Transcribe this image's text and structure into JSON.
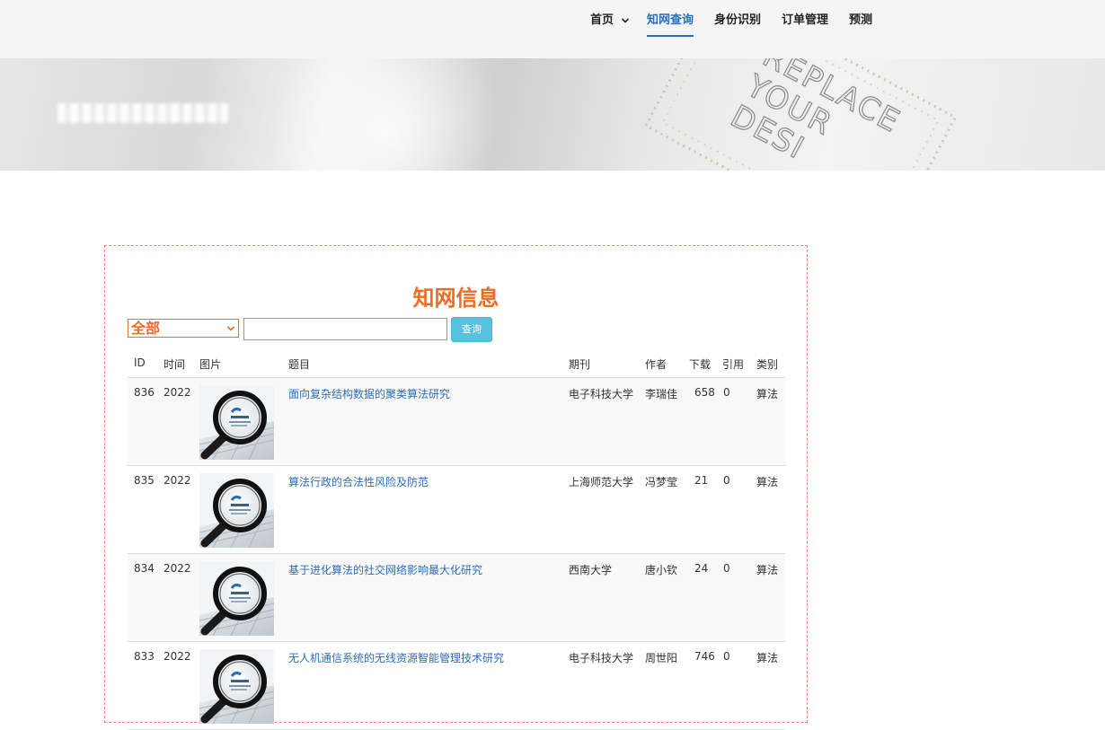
{
  "nav": {
    "items": [
      {
        "label": "首页",
        "has_dropdown": true,
        "active": false
      },
      {
        "label": "知网查询",
        "has_dropdown": false,
        "active": true
      },
      {
        "label": "身份识别",
        "has_dropdown": false,
        "active": false
      },
      {
        "label": "订单管理",
        "has_dropdown": false,
        "active": false
      },
      {
        "label": "预测",
        "has_dropdown": false,
        "active": false
      }
    ]
  },
  "banner": {
    "stamp_text": [
      "REPLACE",
      "YOUR",
      "DESI"
    ]
  },
  "panel": {
    "title": "知网信息",
    "filter": {
      "selected": "全部"
    },
    "search": {
      "value": "",
      "button_label": "查询"
    }
  },
  "table": {
    "headers": {
      "id": "ID",
      "time": "时间",
      "image": "图片",
      "title": "题目",
      "journal": "期刊",
      "author": "作者",
      "downloads": "下载",
      "citations": "引用",
      "category": "类别"
    },
    "rows": [
      {
        "id": "836",
        "time": "2022",
        "title": "面向复杂结构数据的聚类算法研究",
        "journal": "电子科技大学",
        "author": "李瑞佳",
        "downloads": "658",
        "citations": "0",
        "category": "算法"
      },
      {
        "id": "835",
        "time": "2022",
        "title": "算法行政的合法性风险及防范",
        "journal": "上海师范大学",
        "author": "冯梦莹",
        "downloads": "21",
        "citations": "0",
        "category": "算法"
      },
      {
        "id": "834",
        "time": "2022",
        "title": "基于进化算法的社交网络影响最大化研究",
        "journal": "西南大学",
        "author": "唐小钦",
        "downloads": "24",
        "citations": "0",
        "category": "算法"
      },
      {
        "id": "833",
        "time": "2022",
        "title": "无人机通信系统的无线资源智能管理技术研究",
        "journal": "电子科技大学",
        "author": "周世阳",
        "downloads": "746",
        "citations": "0",
        "category": "算法"
      }
    ]
  },
  "colors": {
    "accent_orange": "#f26b22",
    "link_blue": "#2a6ebb",
    "button_blue": "#5bc0de"
  }
}
